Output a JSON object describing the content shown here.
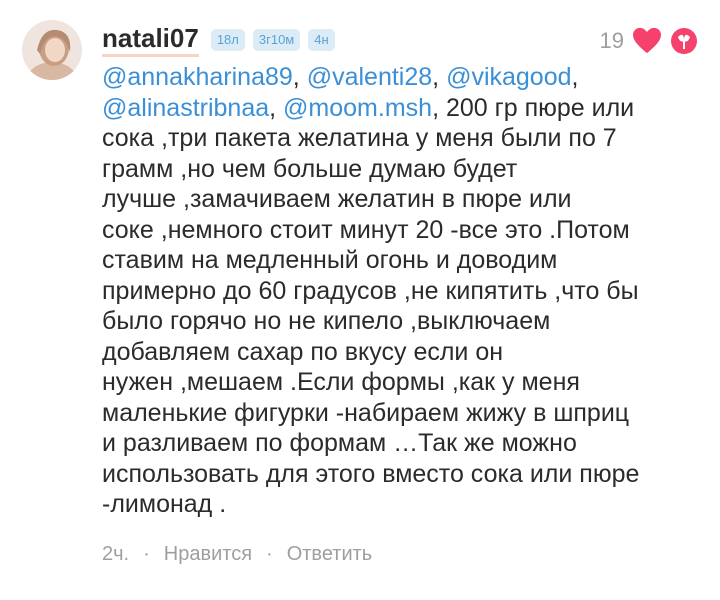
{
  "user": {
    "username": "natali07",
    "badges": [
      "18л",
      "3г10м",
      "4н"
    ]
  },
  "likes": {
    "count": "19"
  },
  "comment": {
    "mentions": [
      "@annakharina89",
      "@valenti28",
      "@vikagood",
      "@alinastribnaa",
      "@moom.msh"
    ],
    "separator": ", ",
    "lines": [
      " 200 гр пюре или",
      "сока ,три пакета желатина у меня были по 7",
      "грамм ,но чем больше думаю будет",
      "лучше ,замачиваем желатин в пюре или",
      "соке ,немного стоит минут 20 -все это .Потом",
      "ставим на медленный огонь и доводим",
      "примерно до 60 градусов ,не кипятить ,что бы",
      "было горячо но не кипело ,выключаем",
      "добавляем сахар по вкусу если он",
      "нужен ,мешаем .Если формы ,как у меня",
      "маленькие фигурки -набираем жижу в шприц",
      "и разливаем по формам …Так же можно",
      "использовать для этого вместо сока или пюре",
      "-лимонад ."
    ]
  },
  "footer": {
    "time": "2ч.",
    "dot": "·",
    "like_label": "Нравится",
    "reply_label": "Ответить"
  },
  "icons": {
    "heart": "heart-icon",
    "emblem": "emblem-icon"
  },
  "colors": {
    "mention": "#3b8fd6",
    "heart": "#f5416c",
    "badge_bg": "#dcecf7",
    "badge_text": "#5aa2d6",
    "muted": "#9e9e9e"
  }
}
